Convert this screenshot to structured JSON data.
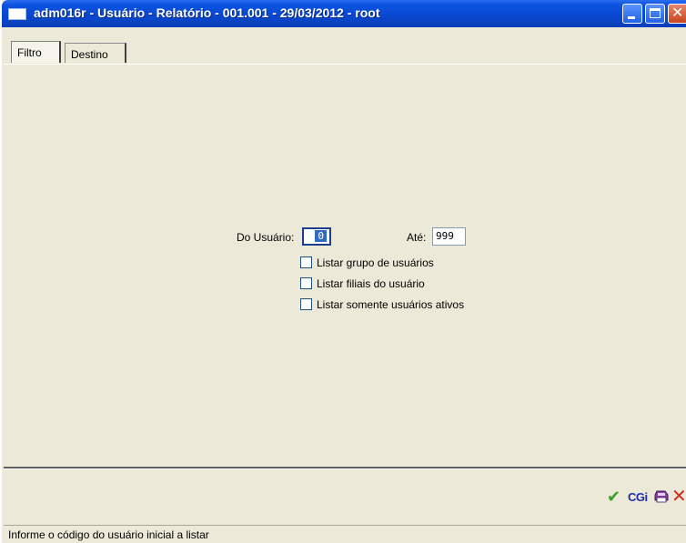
{
  "window": {
    "title": "adm016r - Usuário - Relatório - 001.001 - 29/03/2012 - root"
  },
  "tabs": [
    {
      "label": "Filtro",
      "active": true
    },
    {
      "label": "Destino",
      "active": false
    }
  ],
  "form": {
    "from_label": "Do Usuário:",
    "from_value": "0",
    "to_label": "Até:",
    "to_value": "999",
    "checkboxes": [
      {
        "label": "Listar grupo de usuários",
        "checked": false
      },
      {
        "label": "Listar filiais do usuário",
        "checked": false
      },
      {
        "label": "Listar somente usuários ativos",
        "checked": false
      }
    ]
  },
  "actions": {
    "confirm_icon": "checkmark-icon",
    "cgi_label": "CGi",
    "print_icon": "printer-icon",
    "cancel_icon": "close-x-icon"
  },
  "colors": {
    "titlebar": "#0a47cf",
    "confirm": "#35a02a",
    "cgi": "#1b2fa8",
    "cancel": "#d42a1a"
  },
  "statusbar": {
    "text": "Informe o código do usuário inicial a listar"
  }
}
